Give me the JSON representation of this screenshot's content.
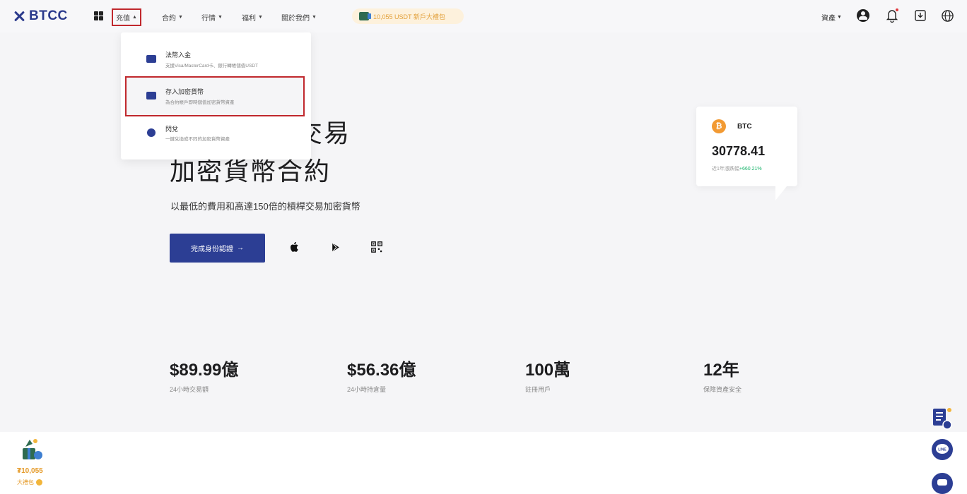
{
  "brand": {
    "name": "BTCC",
    "color": "#2b3a8c"
  },
  "nav": {
    "items": [
      {
        "label": "充值",
        "caret": "▲"
      },
      {
        "label": "合約",
        "caret": "▼"
      },
      {
        "label": "行情",
        "caret": "▼"
      },
      {
        "label": "福利",
        "caret": "▼"
      },
      {
        "label": "關於我們",
        "caret": "▼"
      }
    ],
    "promo": "10,055 USDT 新戶大禮包",
    "assets": "資產",
    "assets_caret": "▼"
  },
  "dropdown": {
    "items": [
      {
        "title": "法幣入金",
        "desc": "支援Visa/MasterCard卡、銀行轉帳儲值USDT",
        "icon": "card-icon"
      },
      {
        "title": "存入加密貨幣",
        "desc": "為合約帳戶即時儲值加密貨幣資產",
        "icon": "wallet-icon"
      },
      {
        "title": "閃兌",
        "desc": "一鍵兌換成不同的加密貨幣資產",
        "icon": "exchange-icon"
      }
    ]
  },
  "hero": {
    "title_line1": "交易",
    "title_line2": "加密貨幣合約",
    "subtitle": "以最低的費用和高達150倍的槓桿交易加密貨幣",
    "cta": "完成身份認證",
    "cta_arrow": "→"
  },
  "btc_card": {
    "coin_glyph": "₿",
    "symbol": "BTC",
    "price": "30778.41",
    "change_label": "近1年漲跌幅",
    "change_value": "+660.21%"
  },
  "stats": [
    {
      "value": "$89.99億",
      "label": "24小時交易額"
    },
    {
      "value": "$56.36億",
      "label": "24小時持倉量"
    },
    {
      "value": "100萬",
      "label": "註冊用戶"
    },
    {
      "value": "12年",
      "label": "保障資產安全"
    }
  ],
  "gift": {
    "amount": "₮10,055",
    "label": "大禮包"
  },
  "colors": {
    "primary": "#2c3e94",
    "accent_red": "#c0282d",
    "positive": "#19b36b",
    "gold": "#e59b2a"
  }
}
